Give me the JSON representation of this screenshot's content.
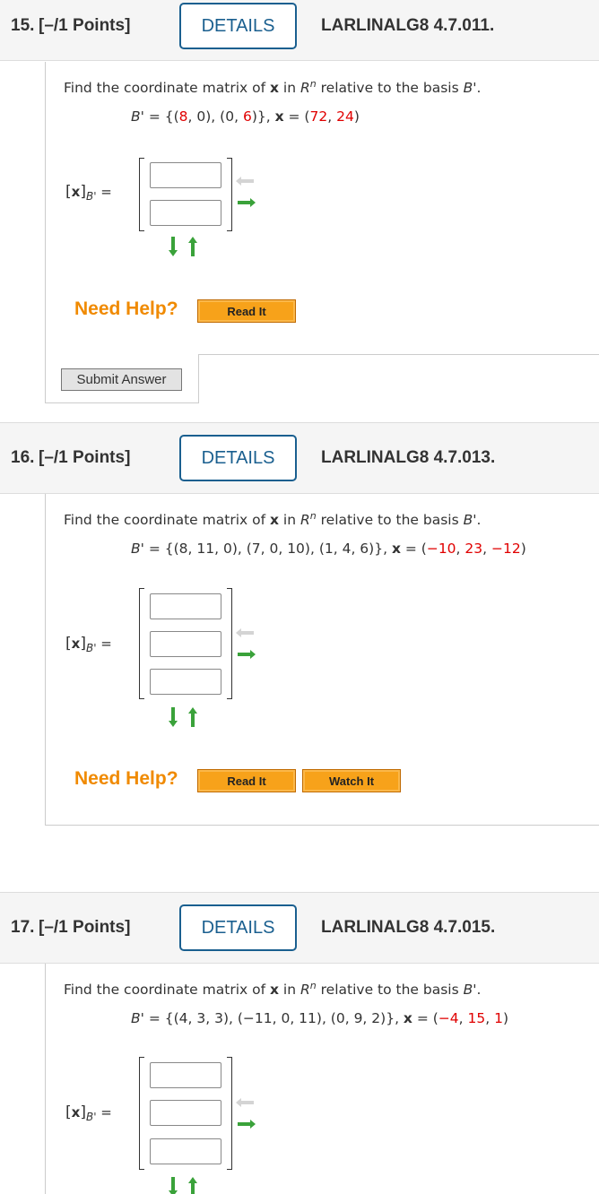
{
  "details_label": "DETAILS",
  "need_help_label": "Need Help?",
  "submit_label": "Submit Answer",
  "prompt": {
    "part1": "Find the coordinate matrix of ",
    "x_bold": "x",
    "part2": " in ",
    "R": "R",
    "n": "n",
    "part3": " relative to the basis ",
    "Bp": "B'",
    "end": "."
  },
  "matrix_label": {
    "open": "[",
    "x": "x",
    "close": "]",
    "sub": "B'",
    "eq": " ="
  },
  "colors": {
    "accent_blue": "#1a5f8f",
    "help_orange": "#f08a00",
    "button_orange": "#f7a21a",
    "value_red": "#e00000",
    "arrow_green": "#3aa23a"
  },
  "questions": [
    {
      "number": "15.",
      "points": "[–/1 Points]",
      "code": "LARLINALG8 4.7.011.",
      "basis_prefix": "B' = {(",
      "basis": [
        {
          "values": [
            "8",
            "0"
          ],
          "red_index": [
            0
          ]
        },
        {
          "values": [
            "0",
            "6"
          ],
          "red_index": [
            1
          ]
        }
      ],
      "basis_text_parts": [
        "(",
        "8",
        ", 0), (0, ",
        "6",
        ")}"
      ],
      "x_values": [
        "72",
        "24"
      ],
      "matrix_size": 2,
      "help_buttons": [
        "Read It"
      ],
      "has_submit": true
    },
    {
      "number": "16.",
      "points": "[–/1 Points]",
      "code": "LARLINALG8 4.7.013.",
      "basis_text": "{(8, 11, 0), (7, 0, 10), (1, 4, 6)}",
      "x_values": [
        "−10",
        "23",
        "−12"
      ],
      "matrix_size": 3,
      "help_buttons": [
        "Read It",
        "Watch It"
      ],
      "has_submit": false
    },
    {
      "number": "17.",
      "points": "[–/1 Points]",
      "code": "LARLINALG8 4.7.015.",
      "basis_text": "{(4, 3, 3), (−11, 0, 11), (0, 9, 2)}",
      "x_values": [
        "−4",
        "15",
        "1"
      ],
      "matrix_size": 3,
      "help_buttons": [],
      "has_submit": false
    }
  ],
  "q15_basis": {
    "pre": "{(",
    "a": "8",
    "mid1": ", 0), (0, ",
    "b": "6",
    "post": ")}"
  },
  "x_eq": {
    "comma": ", ",
    "x": "x",
    "eq": " = (",
    "close": ")",
    "sep": ", "
  },
  "bp_eq": {
    "Bp": "B'",
    "eq": " = "
  }
}
